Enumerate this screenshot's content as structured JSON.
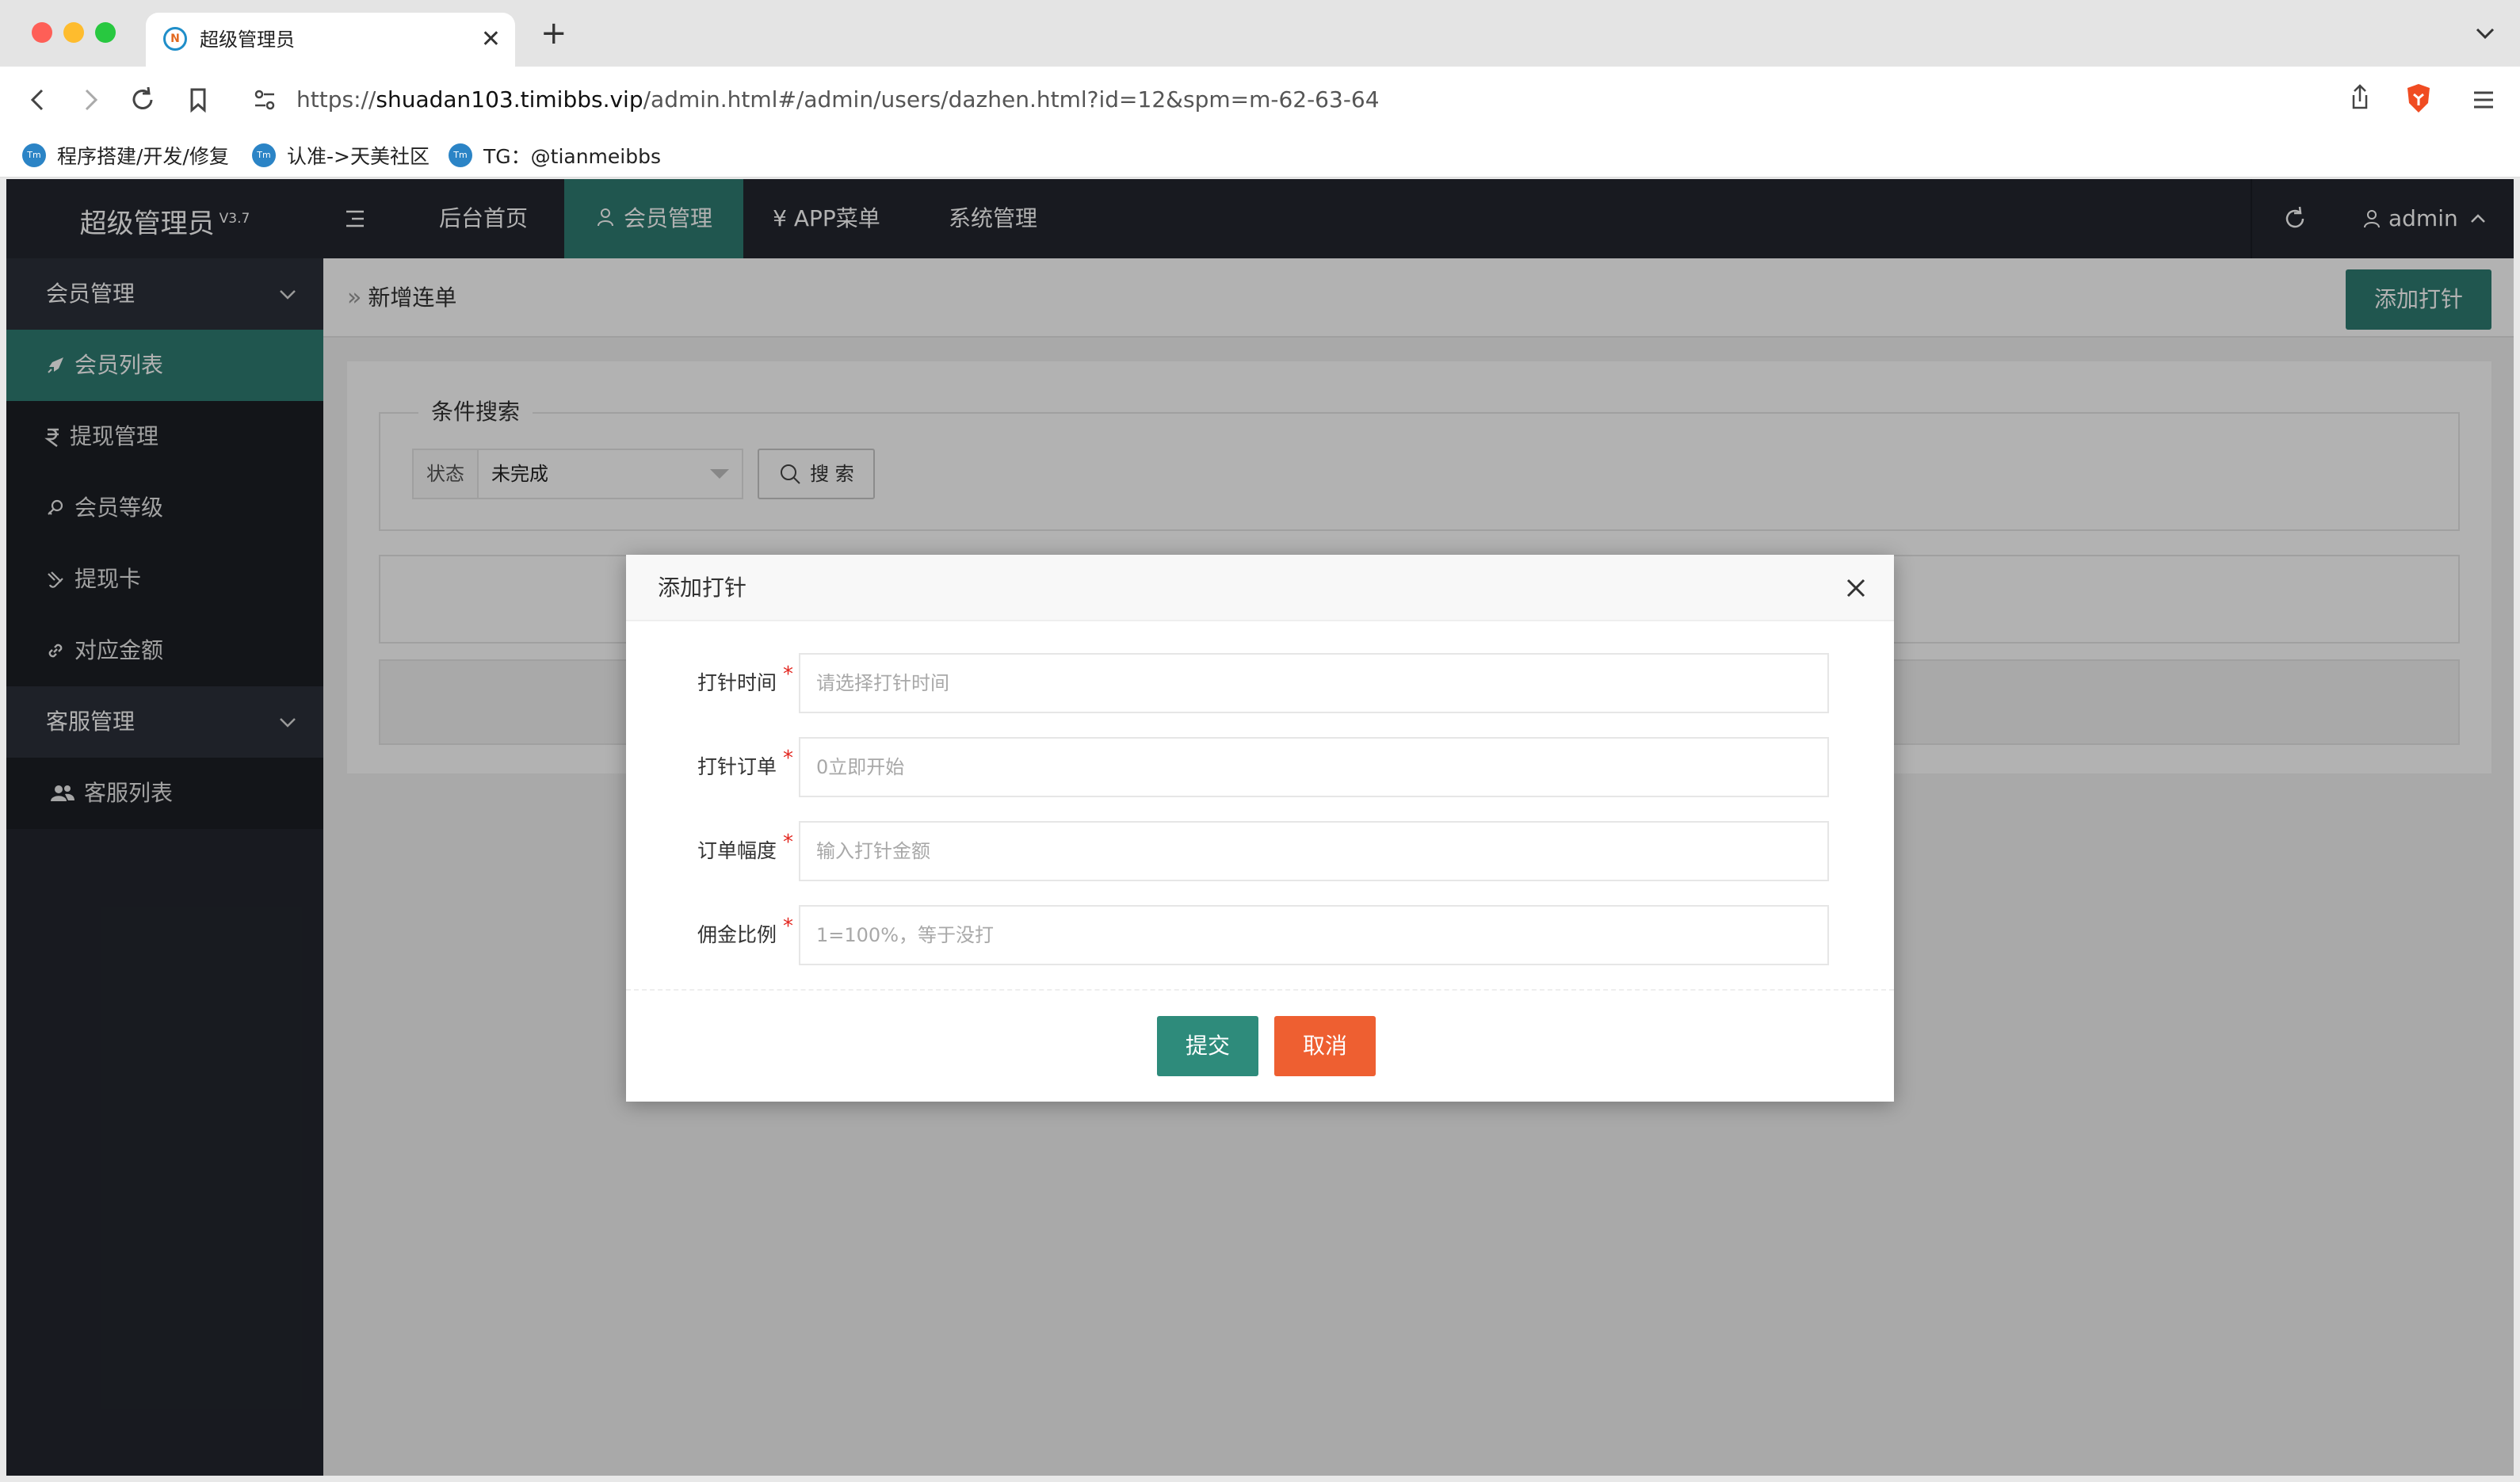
{
  "browser": {
    "tab_title": "超级管理员",
    "url_prefix": "https://",
    "url_host": "shuadan103.timibbs.vip",
    "url_path": "/admin.html#/admin/users/dazhen.html?id=12&spm=m-62-63-64",
    "bookmarks": [
      {
        "label": "程序搭建/开发/修复"
      },
      {
        "label": "认准->天美社区"
      },
      {
        "label": "TG：@tianmeibbs"
      }
    ]
  },
  "app": {
    "logo_text": "超级管理员",
    "version": "V3.7",
    "topnav": [
      {
        "label": "后台首页"
      },
      {
        "label": "会员管理"
      },
      {
        "label": "¥ APP菜单"
      },
      {
        "label": "系统管理"
      }
    ],
    "user_name": "admin"
  },
  "sidebar": {
    "groups": [
      {
        "label": "会员管理"
      },
      {
        "label": "客服管理"
      }
    ],
    "items": [
      {
        "label": "会员列表",
        "icon": "rocket-icon"
      },
      {
        "label": "提现管理",
        "icon": "rupee-icon"
      },
      {
        "label": "会员等级",
        "icon": "key-icon"
      },
      {
        "label": "提现卡",
        "icon": "card-icon"
      },
      {
        "label": "对应金额",
        "icon": "link-icon"
      },
      {
        "label": "客服列表",
        "icon": "users-icon"
      }
    ]
  },
  "content": {
    "breadcrumb": "新增连单",
    "add_button": "添加打针",
    "search": {
      "legend": "条件搜索",
      "status_label": "状态",
      "status_value": "未完成",
      "search_button": "搜 索"
    }
  },
  "modal": {
    "title": "添加打针",
    "fields": [
      {
        "label": "打针时间",
        "placeholder": "请选择打针时间",
        "value": ""
      },
      {
        "label": "打针订单",
        "placeholder": "0立即开始",
        "value": ""
      },
      {
        "label": "订单幅度",
        "placeholder": "输入打针金额",
        "value": ""
      },
      {
        "label": "佣金比例",
        "placeholder": "1=100%，等于没打",
        "value": ""
      }
    ],
    "required_mark": "*",
    "submit_label": "提交",
    "cancel_label": "取消"
  },
  "colors": {
    "accent": "#2e7b72",
    "header_bg": "#23262e",
    "cancel": "#ee5f31"
  }
}
